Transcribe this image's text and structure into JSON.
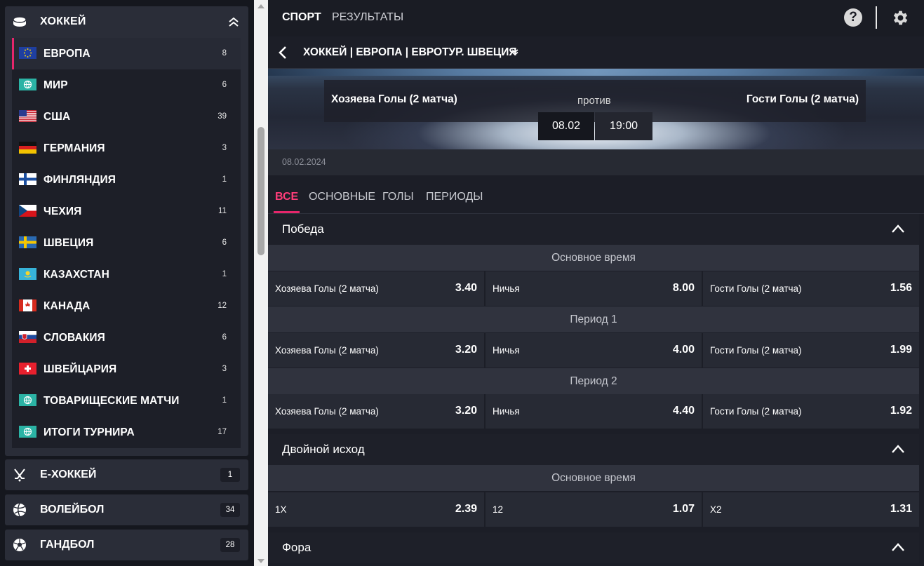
{
  "sidebar": {
    "sport_title": "ХОККЕЙ",
    "countries": [
      {
        "name": "ЕВРОПА",
        "count": "8",
        "flag": "eu"
      },
      {
        "name": "МИР",
        "count": "6",
        "flag": "globe"
      },
      {
        "name": "США",
        "count": "39",
        "flag": "us"
      },
      {
        "name": "ГЕРМАНИЯ",
        "count": "3",
        "flag": "de"
      },
      {
        "name": "ФИНЛЯНДИЯ",
        "count": "1",
        "flag": "fi"
      },
      {
        "name": "ЧЕХИЯ",
        "count": "11",
        "flag": "cz"
      },
      {
        "name": "ШВЕЦИЯ",
        "count": "6",
        "flag": "se"
      },
      {
        "name": "КАЗАХСТАН",
        "count": "1",
        "flag": "kz"
      },
      {
        "name": "КАНАДА",
        "count": "12",
        "flag": "ca"
      },
      {
        "name": "СЛОВАКИЯ",
        "count": "6",
        "flag": "sk"
      },
      {
        "name": "ШВЕЙЦАРИЯ",
        "count": "3",
        "flag": "ch"
      },
      {
        "name": "ТОВАРИЩЕСКИЕ МАТЧИ",
        "count": "1",
        "flag": "globe"
      },
      {
        "name": "ИТОГИ ТУРНИРА",
        "count": "17",
        "flag": "globe"
      }
    ],
    "sports": [
      {
        "name": "Е-ХОККЕЙ",
        "count": "1",
        "icon": "hockey-sticks-icon"
      },
      {
        "name": "ВОЛЕЙБОЛ",
        "count": "34",
        "icon": "volleyball-icon"
      },
      {
        "name": "ГАНДБОЛ",
        "count": "28",
        "icon": "handball-icon"
      }
    ]
  },
  "topnav": {
    "sport": "СПОРТ",
    "results": "РЕЗУЛЬТАТЫ",
    "help": "?"
  },
  "breadcrumb": "ХОККЕЙ | ЕВРОПА | ЕВРОТУР. ШВЕЦИЯ",
  "match": {
    "home": "Хозяева Голы (2 матча)",
    "vs": "против",
    "away": "Гости Голы (2 матча)",
    "date": "08.02",
    "time": "19:00",
    "full_date": "08.02.2024"
  },
  "market_tabs": [
    "ВСЕ",
    "ОСНОВНЫЕ",
    "ГОЛЫ",
    "ПЕРИОДЫ"
  ],
  "markets": {
    "win": {
      "title": "Победа",
      "groups": [
        {
          "title": "Основное время",
          "odds": [
            {
              "label": "Хозяева Голы (2 матча)",
              "value": "3.40"
            },
            {
              "label": "Ничья",
              "value": "8.00"
            },
            {
              "label": "Гости Голы (2 матча)",
              "value": "1.56"
            }
          ]
        },
        {
          "title": "Период 1",
          "odds": [
            {
              "label": "Хозяева Голы (2 матча)",
              "value": "3.20"
            },
            {
              "label": "Ничья",
              "value": "4.00"
            },
            {
              "label": "Гости Голы (2 матча)",
              "value": "1.99"
            }
          ]
        },
        {
          "title": "Период 2",
          "odds": [
            {
              "label": "Хозяева Голы (2 матча)",
              "value": "3.20"
            },
            {
              "label": "Ничья",
              "value": "4.40"
            },
            {
              "label": "Гости Голы (2 матча)",
              "value": "1.92"
            }
          ]
        }
      ]
    },
    "double": {
      "title": "Двойной исход",
      "groups": [
        {
          "title": "Основное время",
          "odds": [
            {
              "label": "1X",
              "value": "2.39"
            },
            {
              "label": "12",
              "value": "1.07"
            },
            {
              "label": "X2",
              "value": "1.31"
            }
          ]
        }
      ]
    },
    "handicap": {
      "title": "Фора"
    }
  },
  "colors": {
    "accent": "#e6266b",
    "background": "#1c1e27",
    "panel": "#2a2d38"
  }
}
